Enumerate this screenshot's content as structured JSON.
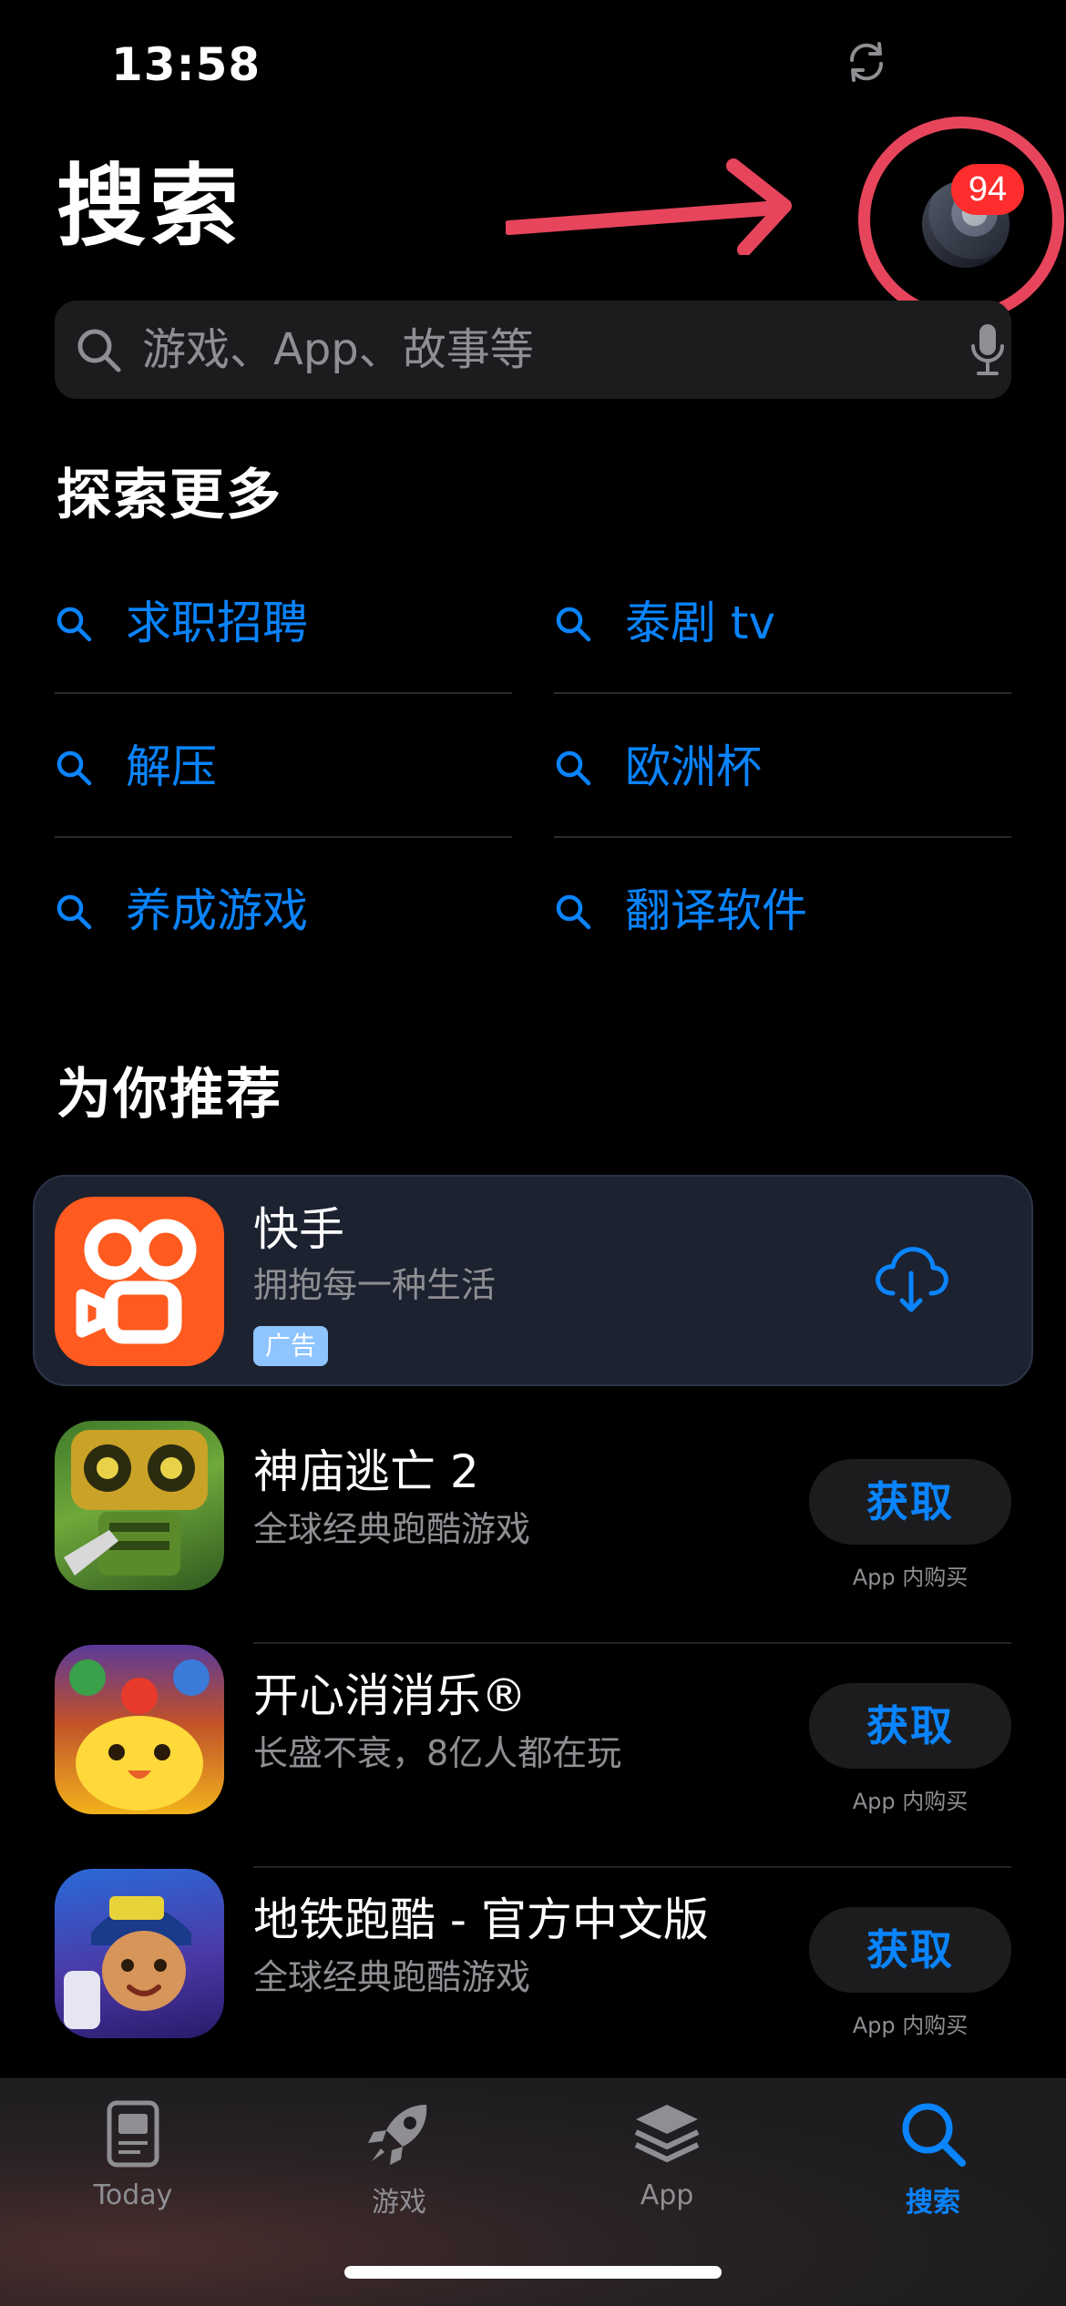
{
  "status_bar": {
    "time": "13:58"
  },
  "header": {
    "title": "搜索",
    "badge_count": "94"
  },
  "search": {
    "placeholder": "游戏、App、故事等"
  },
  "explore": {
    "title": "探索更多",
    "items": [
      {
        "label": "求职招聘"
      },
      {
        "label": "泰剧 tv"
      },
      {
        "label": "解压"
      },
      {
        "label": "欧洲杯"
      },
      {
        "label": "养成游戏"
      },
      {
        "label": "翻译软件"
      }
    ]
  },
  "recommend": {
    "title": "为你推荐",
    "ad": {
      "name": "快手",
      "subtitle": "拥抱每一种生活",
      "tag": "广告"
    },
    "apps": [
      {
        "name": "神庙逃亡 2",
        "subtitle": "全球经典跑酷游戏",
        "button": "获取",
        "note": "App 内购买"
      },
      {
        "name": "开心消消乐®",
        "subtitle": "长盛不衰，8亿人都在玩",
        "button": "获取",
        "note": "App 内购买"
      },
      {
        "name": "地铁跑酷 - 官方中文版",
        "subtitle": "全球经典跑酷游戏",
        "button": "获取",
        "note": "App 内购买"
      }
    ]
  },
  "tab_bar": {
    "tabs": [
      {
        "label": "Today",
        "icon": "today-icon"
      },
      {
        "label": "游戏",
        "icon": "rocket-icon"
      },
      {
        "label": "App",
        "icon": "layers-icon"
      },
      {
        "label": "搜索",
        "icon": "search-icon",
        "active": true
      }
    ]
  },
  "colors": {
    "accent": "#0a84ff",
    "annotation": "#e7455c",
    "badge": "#ff2d2d",
    "kuaishou": "#ff5a1f"
  }
}
